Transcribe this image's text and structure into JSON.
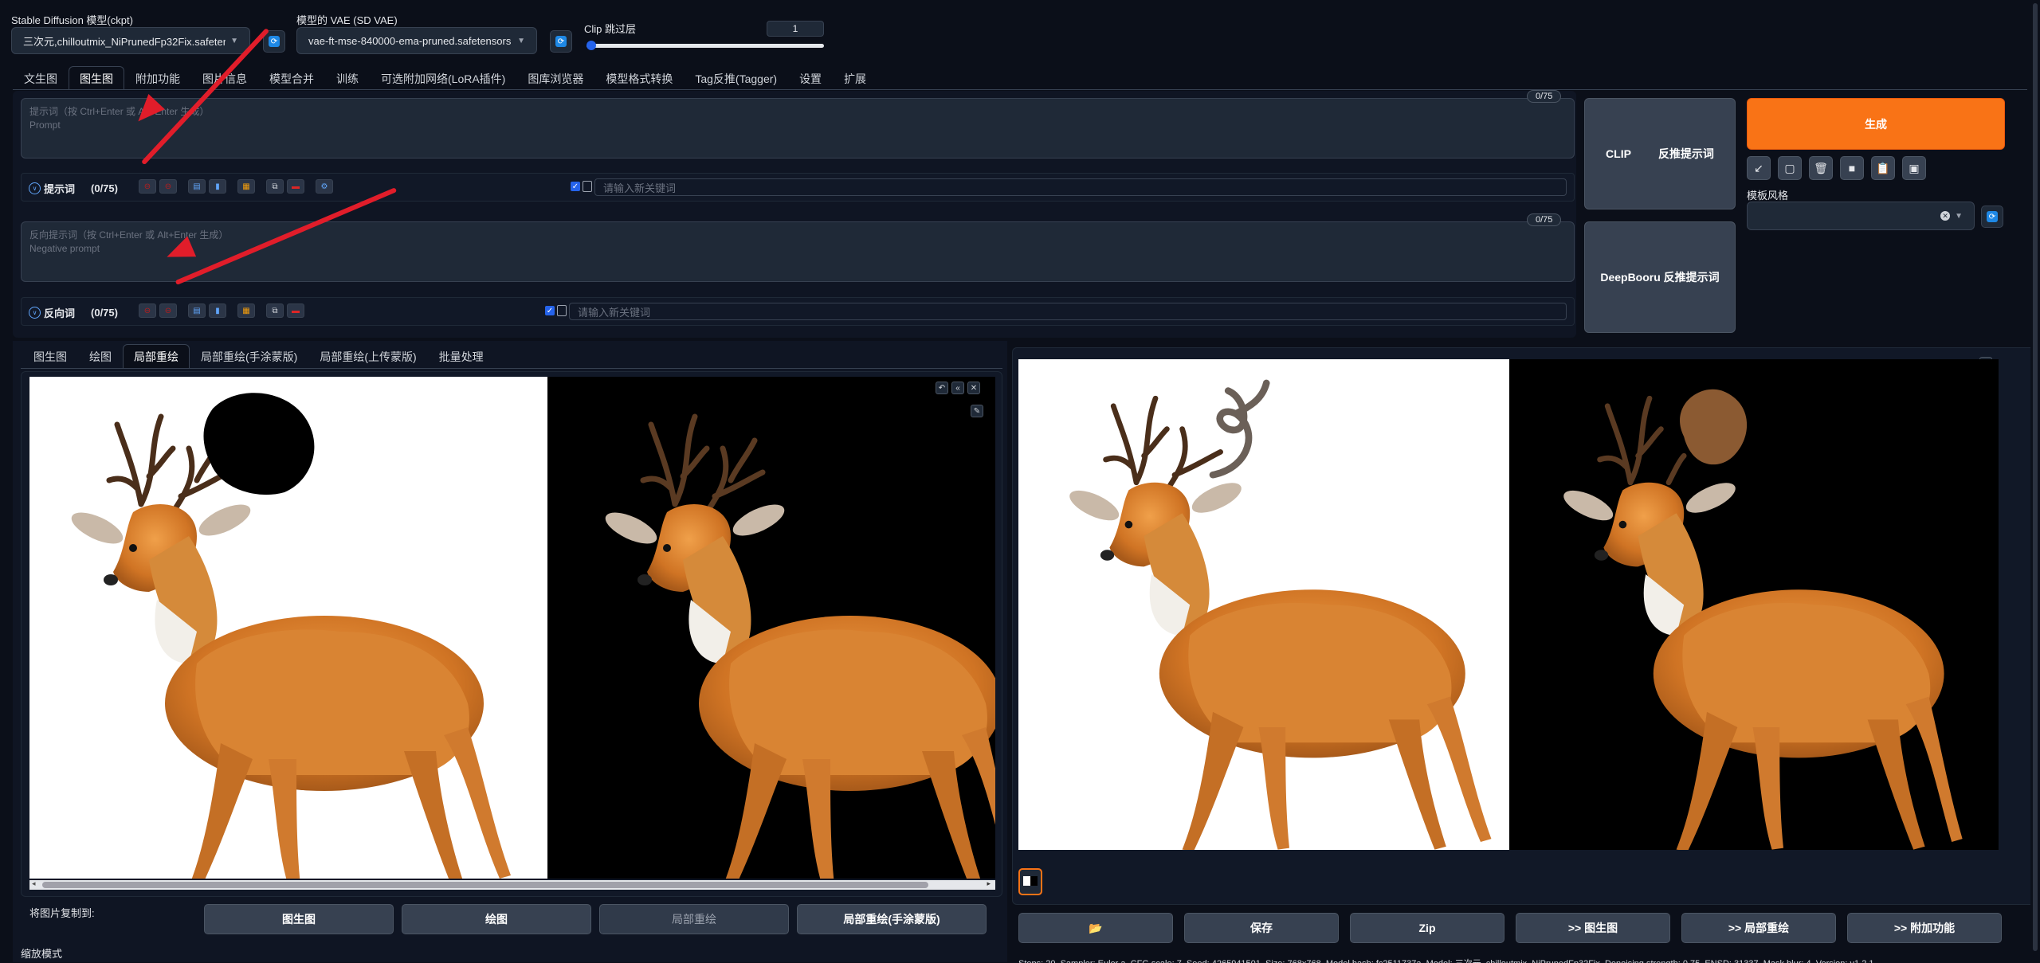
{
  "top": {
    "model_label": "Stable Diffusion 模型(ckpt)",
    "model_value": "三次元,chilloutmix_NiPrunedFp32Fix.safetensors",
    "vae_label": "模型的 VAE (SD VAE)",
    "vae_value": "vae-ft-mse-840000-ema-pruned.safetensors",
    "clip_label": "Clip 跳过层",
    "clip_value": "1",
    "clip_min": 1,
    "clip_max": 12
  },
  "main_tabs": [
    "文生图",
    "图生图",
    "附加功能",
    "图片信息",
    "模型合并",
    "训练",
    "可选附加网络(LoRA插件)",
    "图库浏览器",
    "模型格式转换",
    "Tag反推(Tagger)",
    "设置",
    "扩展"
  ],
  "main_tab_selected": 1,
  "prompt": {
    "placeholder": "提示词（按 Ctrl+Enter 或 Alt+Enter 生成）",
    "sublabel": "Prompt",
    "counter": "0/75",
    "toolbar_label": "提示词",
    "toolbar_count": "(0/75)",
    "keyword_placeholder": "请输入新关键词"
  },
  "negative": {
    "placeholder": "反向提示词（按 Ctrl+Enter 或 Alt+Enter 生成）",
    "sublabel": "Negative prompt",
    "counter": "0/75",
    "toolbar_label": "反向词",
    "toolbar_count": "(0/75)",
    "keyword_placeholder": "请输入新关键词"
  },
  "interrogate": {
    "clip_left": "CLIP",
    "clip_right": "反推提示词",
    "deepbooru": "DeepBooru 反推提示词"
  },
  "generate_label": "生成",
  "style_label": "模板风格",
  "style_tool_icons": [
    "arrow-icon",
    "trash-icon",
    "trash-can-icon",
    "save-style-icon",
    "clipboard-icon",
    "apply-style-icon"
  ],
  "style_tool_glyphs": [
    "↙",
    "▢",
    "🗑",
    "■",
    "📋",
    "▣"
  ],
  "sub_tabs": [
    "图生图",
    "绘图",
    "局部重绘",
    "局部重绘(手涂蒙版)",
    "局部重绘(上传蒙版)",
    "批量处理"
  ],
  "sub_tab_selected": 2,
  "copy_label": "将图片复制到:",
  "copy_buttons": [
    "图生图",
    "绘图",
    "局部重绘",
    "局部重绘(手涂蒙版)"
  ],
  "copy_disabled_index": 2,
  "resize_label": "缩放模式",
  "output_buttons": [
    "📂",
    "保存",
    "Zip",
    ">> 图生图",
    ">> 局部重绘",
    ">> 附加功能"
  ],
  "info_text": "Steps: 20, Sampler: Euler a, CFG scale: 7, Seed: 4265941501, Size: 768x768, Model hash: fc2511737a, Model: 三次元_chilloutmix_NiPrunedFp32Fix, Denoising strength: 0.75, ENSD: 31337, Mask blur: 4, Version: v1.2.1",
  "colors": {
    "accent": "#f97316",
    "bg": "#0b0f19",
    "arrow": "#e11d2a",
    "blue": "#2563eb"
  }
}
